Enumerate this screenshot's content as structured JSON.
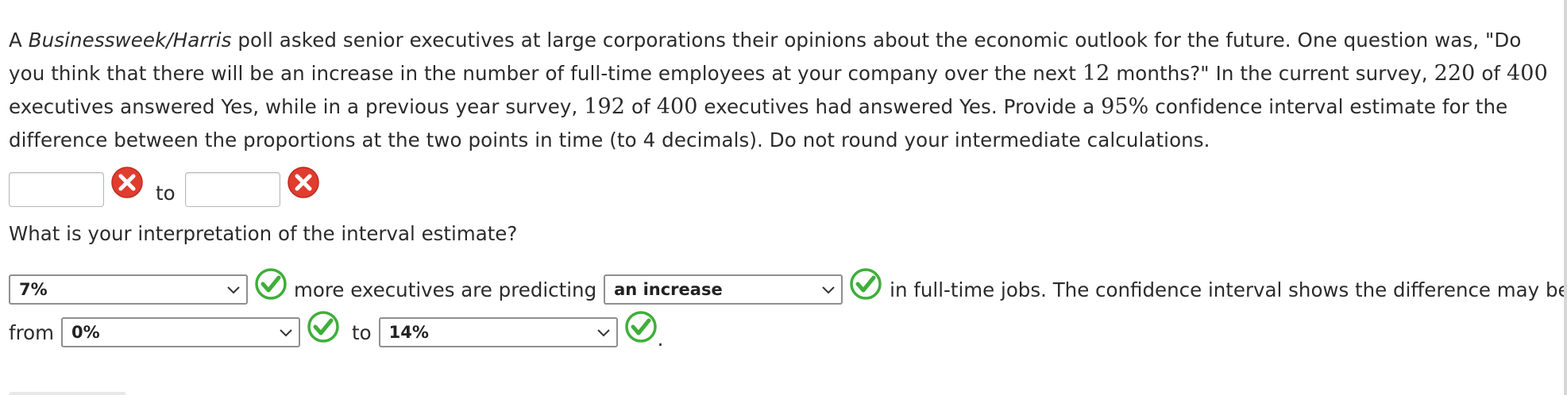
{
  "question": {
    "p1": "A ",
    "source": "Businessweek/Harris",
    "p2": " poll asked senior executives at large corporations their opinions about the economic outlook for the future. One question was, \"Do you think that there will be an increase in the number of full-time employees at your company over the next ",
    "months": "12",
    "p3": " months?\" In the current survey, ",
    "current_yes": "220",
    "p4": " of ",
    "current_total": "400",
    "p5": " executives answered Yes, while in a previous year survey, ",
    "previous_yes": "192",
    "p6": " of ",
    "previous_total": "400",
    "p7": " executives had answered Yes. Provide a ",
    "confidence": "95",
    "percent": "%",
    "p8": " confidence interval estimate for the difference between the proportions at the two points in time (to 4 decimals). Do not round your intermediate calculations."
  },
  "interval": {
    "lower_value": "",
    "to_label": "to",
    "upper_value": "",
    "lower_status": "incorrect",
    "upper_status": "incorrect"
  },
  "interpretation": {
    "prompt": "What is your interpretation of the interval estimate?",
    "select1_value": "7%",
    "text1": "more executives are predicting",
    "select2_value": "an increase",
    "text2": "in full-time jobs. The confidence interval shows the difference may be",
    "from_label": "from",
    "select3_value": "0%",
    "to_label": "to",
    "select4_value": "14%",
    "end_punct": ".",
    "statuses": [
      "correct",
      "correct",
      "correct",
      "correct"
    ]
  },
  "colors": {
    "incorrect": "#e03c2f",
    "correct": "#3fae3a",
    "text": "#2b2b2b"
  }
}
